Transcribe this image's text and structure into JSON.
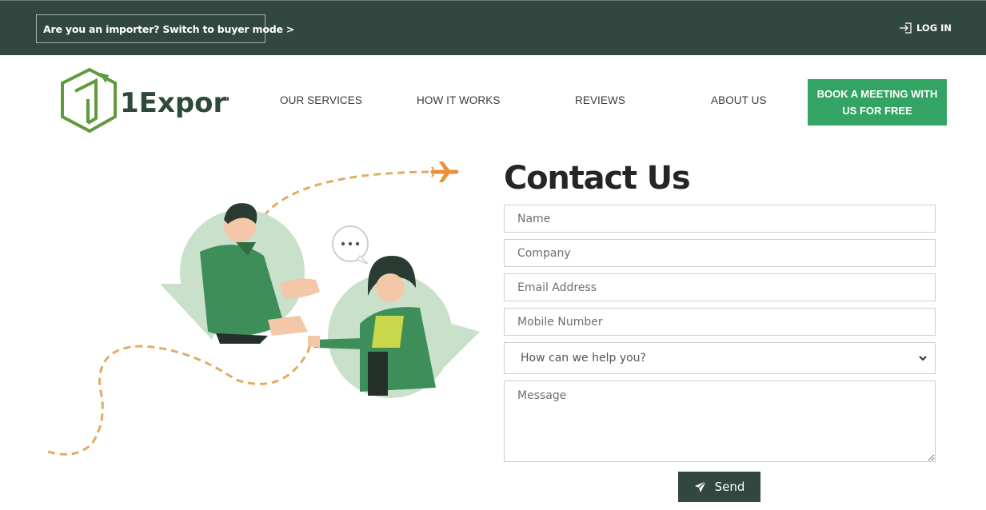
{
  "topbar": {
    "buyer_mode_label": "Are you an importer? Switch to buyer mode >",
    "login_label": "LOG IN",
    "login_icon": "login-arrow-icon"
  },
  "brand": {
    "name": "1Export",
    "logo_icon": "hexagon-box-logo",
    "colors": {
      "dark": "#324740",
      "green": "#33a464",
      "logo_green": "#5f9a3c"
    }
  },
  "nav": {
    "items": [
      {
        "label": "OUR SERVICES"
      },
      {
        "label": "HOW IT WORKS"
      },
      {
        "label": "REVIEWS"
      },
      {
        "label": "ABOUT US"
      }
    ],
    "cta_line1": "BOOK A MEETING WITH",
    "cta_line2": "US FOR FREE"
  },
  "contact": {
    "title": "Contact Us",
    "fields": {
      "name_placeholder": "Name",
      "company_placeholder": "Company",
      "email_placeholder": "Email Address",
      "mobile_placeholder": "Mobile Number",
      "help_selected": "How can we help you?",
      "message_placeholder": "Message"
    },
    "send_label": "Send",
    "send_icon": "paper-plane-icon"
  }
}
